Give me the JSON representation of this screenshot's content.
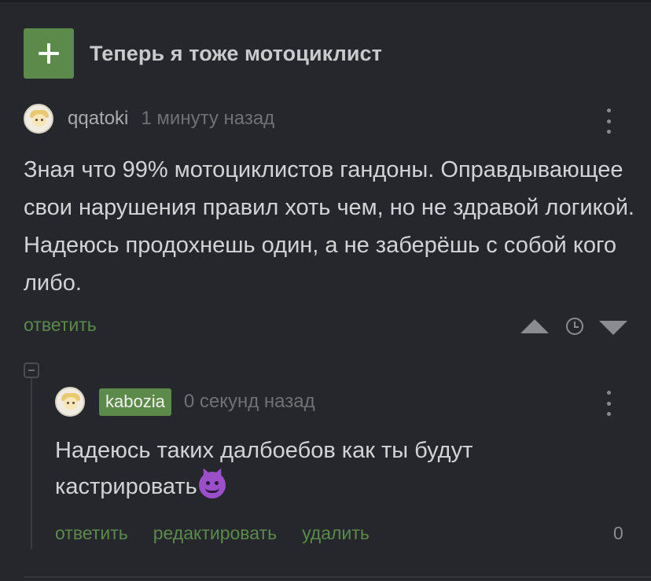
{
  "post": {
    "add_icon": "plus-icon",
    "title": "Теперь я тоже мотоциклист"
  },
  "comment1": {
    "username": "qqatoki",
    "time": "1 минуту назад",
    "text": "Зная что 99% мотоциклистов гандоны. Оправдывающее свои нарушения правил хоть чем, но не здравой логикой. Надеюсь продохнешь один, а не заберёшь с собой кого либо.",
    "reply_label": "ответить",
    "icons": [
      "more-icon",
      "upvote-icon",
      "clock-icon",
      "downvote-icon"
    ]
  },
  "comment2": {
    "username": "kabozia",
    "time": "0 секунд назад",
    "text": "Надеюсь таких далбоебов как ты будут кастрировать",
    "emoji": "smiling-devil-emoji",
    "reply_label": "ответить",
    "edit_label": "редактировать",
    "delete_label": "удалить",
    "score": "0"
  },
  "colors": {
    "background": "#25272c",
    "accent": "#5b8a4a"
  }
}
